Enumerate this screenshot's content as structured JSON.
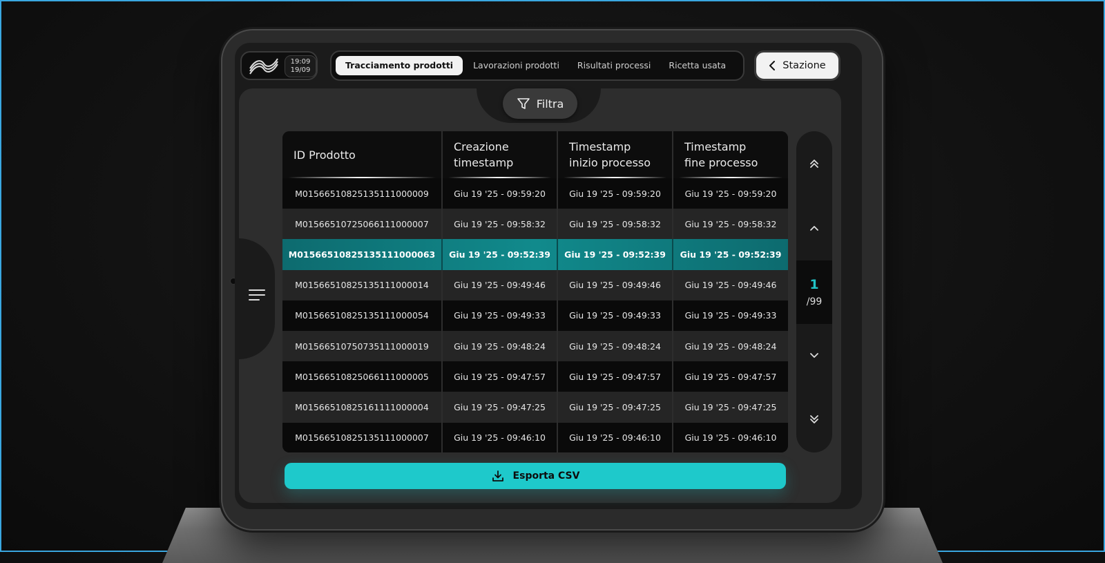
{
  "header": {
    "clock_time": "19:09",
    "clock_date": "19/09",
    "tabs": [
      {
        "label": "Tracciamento prodotti",
        "active": true
      },
      {
        "label": "Lavorazioni prodotti",
        "active": false
      },
      {
        "label": "Risultati processi",
        "active": false
      },
      {
        "label": "Ricetta usata",
        "active": false
      }
    ],
    "station_label": "Stazione"
  },
  "filter_label": "Filtra",
  "table": {
    "headers": [
      "ID Prodotto",
      "Creazione\ntimestamp",
      "Timestamp\ninizio processo",
      "Timestamp\nfine processo"
    ],
    "rows": [
      [
        "M01566510825135111000009",
        "Giu 19 '25 - 09:59:20",
        "Giu 19 '25 - 09:59:20",
        "Giu 19 '25 - 09:59:20"
      ],
      [
        "M01566510725066111000007",
        "Giu 19 '25 - 09:58:32",
        "Giu 19 '25 - 09:58:32",
        "Giu 19 '25 - 09:58:32"
      ],
      [
        "M01566510825135111000063",
        "Giu 19 '25 - 09:52:39",
        "Giu 19 '25 - 09:52:39",
        "Giu 19 '25 - 09:52:39"
      ],
      [
        "M01566510825135111000014",
        "Giu 19 '25 - 09:49:46",
        "Giu 19 '25 - 09:49:46",
        "Giu 19 '25 - 09:49:46"
      ],
      [
        "M01566510825135111000054",
        "Giu 19 '25 - 09:49:33",
        "Giu 19 '25 - 09:49:33",
        "Giu 19 '25 - 09:49:33"
      ],
      [
        "M01566510750735111000019",
        "Giu 19 '25 - 09:48:24",
        "Giu 19 '25 - 09:48:24",
        "Giu 19 '25 - 09:48:24"
      ],
      [
        "M01566510825066111000005",
        "Giu 19 '25 - 09:47:57",
        "Giu 19 '25 - 09:47:57",
        "Giu 19 '25 - 09:47:57"
      ],
      [
        "M01566510825161111000004",
        "Giu 19 '25 - 09:47:25",
        "Giu 19 '25 - 09:47:25",
        "Giu 19 '25 - 09:47:25"
      ],
      [
        "M01566510825135111000007",
        "Giu 19 '25 - 09:46:10",
        "Giu 19 '25 - 09:46:10",
        "Giu 19 '25 - 09:46:10"
      ]
    ],
    "selected_row": 2
  },
  "pager": {
    "current": "1",
    "total": "/99"
  },
  "export_label": "Esporta CSV",
  "colors": {
    "accent": "#1ec9cb",
    "selected_row": "#118a8c",
    "page_number": "#21c3c6"
  },
  "icons": {
    "logo": "waves-logo-icon",
    "station": "chevron-left-icon",
    "filter": "filter-funnel-icon",
    "menu": "hamburger-menu-icon",
    "first": "double-chevron-up-icon",
    "prev": "chevron-up-icon",
    "next": "chevron-down-icon",
    "last": "double-chevron-down-icon",
    "export": "download-icon"
  }
}
